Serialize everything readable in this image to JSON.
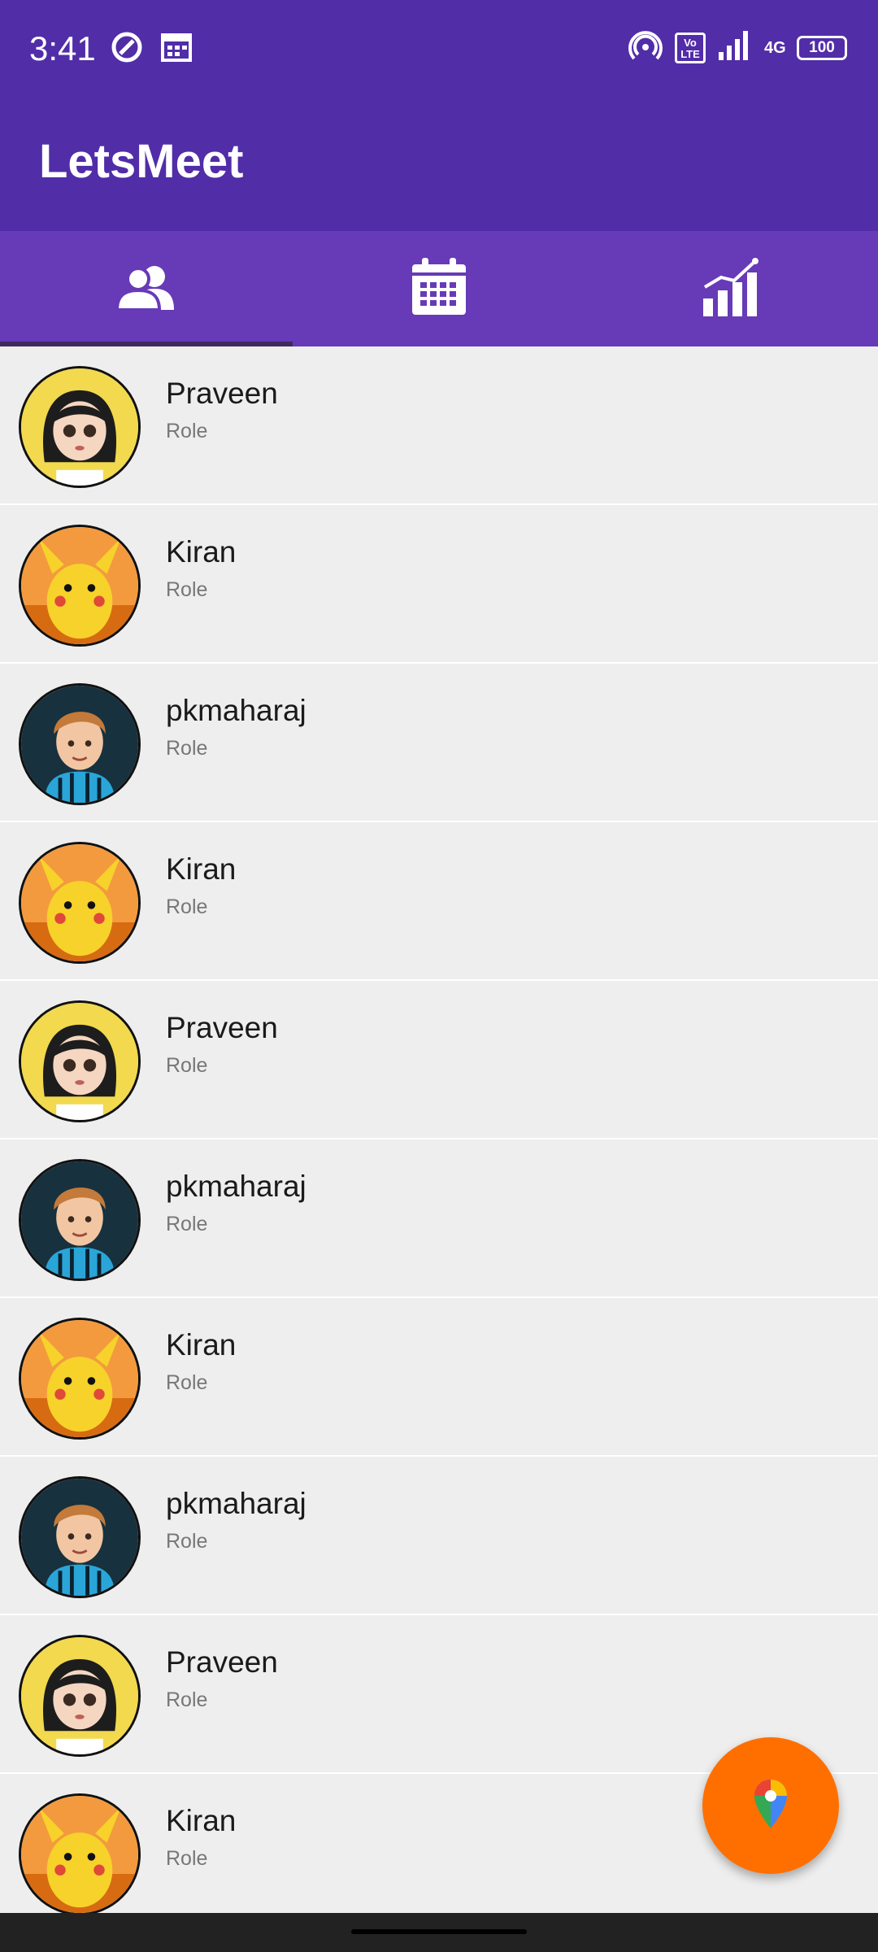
{
  "status_bar": {
    "time": "3:41",
    "battery": "100",
    "network": "4G",
    "volte_label": "Vo LTE",
    "left_icons": [
      "data-saver-icon",
      "calendar-notification-icon"
    ],
    "right_icons": [
      "hotspot-icon",
      "volte-icon",
      "signal-icon",
      "network-4g-icon",
      "battery-icon"
    ]
  },
  "app_bar": {
    "title": "LetsMeet"
  },
  "tabs": [
    {
      "icon": "people-icon",
      "selected": true
    },
    {
      "icon": "calendar-icon",
      "selected": false
    },
    {
      "icon": "bar-chart-icon",
      "selected": false
    }
  ],
  "contacts": [
    {
      "name": "Praveen",
      "role": "Role",
      "avatar": "girl-avatar"
    },
    {
      "name": "Kiran",
      "role": "Role",
      "avatar": "pikachu-avatar"
    },
    {
      "name": "pkmaharaj",
      "role": "Role",
      "avatar": "boy-avatar"
    },
    {
      "name": "Kiran",
      "role": "Role",
      "avatar": "pikachu-avatar"
    },
    {
      "name": "Praveen",
      "role": "Role",
      "avatar": "girl-avatar"
    },
    {
      "name": "pkmaharaj",
      "role": "Role",
      "avatar": "boy-avatar"
    },
    {
      "name": "Kiran",
      "role": "Role",
      "avatar": "pikachu-avatar"
    },
    {
      "name": "pkmaharaj",
      "role": "Role",
      "avatar": "boy-avatar"
    },
    {
      "name": "Praveen",
      "role": "Role",
      "avatar": "girl-avatar"
    },
    {
      "name": "Kiran",
      "role": "Role",
      "avatar": "pikachu-avatar"
    }
  ],
  "fab": {
    "icon": "map-pin-icon"
  },
  "colors": {
    "app_bar": "#512da8",
    "tab_bar": "#673ab7",
    "fab": "#ff6f00",
    "list_background": "#eeeeee"
  }
}
